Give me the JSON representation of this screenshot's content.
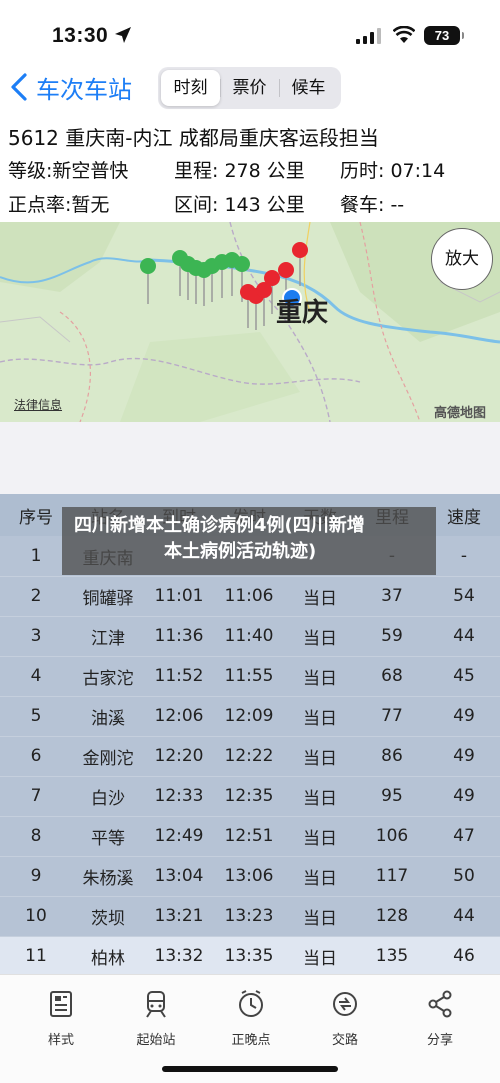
{
  "status_bar": {
    "time": "13:30",
    "battery": "73",
    "icons": [
      "location-arrow-icon",
      "signal-icon",
      "wifi-icon",
      "battery-icon"
    ]
  },
  "nav": {
    "back_label": "车次车站",
    "tabs": [
      {
        "label": "时刻",
        "active": true
      },
      {
        "label": "票价",
        "active": false
      },
      {
        "label": "候车",
        "active": false
      }
    ]
  },
  "train": {
    "headline": "5612  重庆南-内江 成都局重庆客运段担当",
    "grade": "等级:新空普快",
    "distance": "里程: 278 公里",
    "duration": "历时: 07:14",
    "punctuality": "正点率:暂无",
    "section": "区间: 143 公里",
    "dining": "餐车: --"
  },
  "map": {
    "zoom_label": "放大",
    "city_label": "重庆",
    "legal_link": "法律信息",
    "brand": "高德地图",
    "colors": {
      "start": "#2ea84a",
      "end": "#e8262f",
      "current": "#1b7cf0"
    }
  },
  "table": {
    "columns": [
      "序号",
      "站名",
      "到时",
      "发时",
      "天数",
      "里程",
      "速度"
    ],
    "rows": [
      [
        "1",
        "重庆南",
        "",
        "",
        "",
        "-",
        "-"
      ],
      [
        "2",
        "铜罐驿",
        "11:01",
        "11:06",
        "当日",
        "37",
        "54"
      ],
      [
        "3",
        "江津",
        "11:36",
        "11:40",
        "当日",
        "59",
        "44"
      ],
      [
        "4",
        "古家沱",
        "11:52",
        "11:55",
        "当日",
        "68",
        "45"
      ],
      [
        "5",
        "油溪",
        "12:06",
        "12:09",
        "当日",
        "77",
        "49"
      ],
      [
        "6",
        "金刚沱",
        "12:20",
        "12:22",
        "当日",
        "86",
        "49"
      ],
      [
        "7",
        "白沙",
        "12:33",
        "12:35",
        "当日",
        "95",
        "49"
      ],
      [
        "8",
        "平等",
        "12:49",
        "12:51",
        "当日",
        "106",
        "47"
      ],
      [
        "9",
        "朱杨溪",
        "13:04",
        "13:06",
        "当日",
        "117",
        "50"
      ],
      [
        "10",
        "茨坝",
        "13:21",
        "13:23",
        "当日",
        "128",
        "44"
      ],
      [
        "11",
        "柏林",
        "13:32",
        "13:35",
        "当日",
        "135",
        "46"
      ]
    ],
    "colors": {
      "header_bg": "#aebdd0",
      "body_bg": "#b6c3d5",
      "highlight_bg": "#dfe6f1"
    }
  },
  "overlay": {
    "line1": "四川新增本土确诊病例4例(四川新增",
    "line2": "本土病例活动轨迹)"
  },
  "toolbar": {
    "items": [
      {
        "label": "样式",
        "icon": "style-icon"
      },
      {
        "label": "起始站",
        "icon": "train-icon"
      },
      {
        "label": "正晚点",
        "icon": "clock-icon"
      },
      {
        "label": "交路",
        "icon": "route-swap-icon"
      },
      {
        "label": "分享",
        "icon": "share-icon"
      }
    ]
  }
}
